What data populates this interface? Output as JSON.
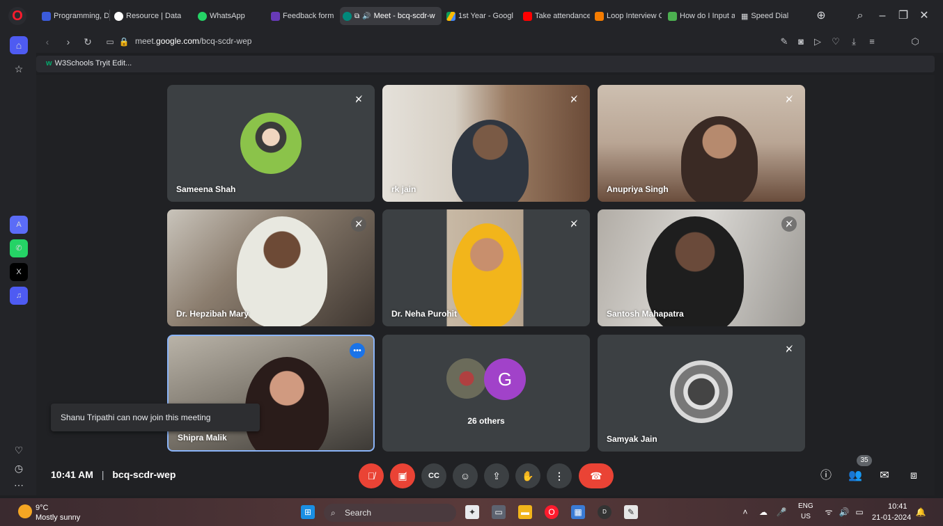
{
  "browser": {
    "tabs": [
      {
        "label": "Programming, D",
        "color": "#3b5bdb"
      },
      {
        "label": "Resource | Data S",
        "color": "#ffffff"
      },
      {
        "label": "WhatsApp",
        "color": "#25d366"
      },
      {
        "label": "Feedback form",
        "color": "#673ab7"
      },
      {
        "label": "Meet - bcq-scdr-w",
        "color": "#00897b"
      },
      {
        "label": "1st Year - Google",
        "color": "#fbbc04"
      },
      {
        "label": "Take attendance",
        "color": "#ff0000"
      },
      {
        "label": "Loop Interview C",
        "color": "#f57c00"
      },
      {
        "label": "How do I Input a",
        "color": "#4caf50"
      },
      {
        "label": "Speed Dial",
        "color": "#9e9e9e"
      }
    ],
    "url_prefix": "meet.",
    "url_domain": "google.com",
    "url_path": "/bcq-scdr-wep",
    "bookmark": "W3Schools Tryit Edit..."
  },
  "meeting": {
    "participants": [
      {
        "name": "Sameena Shah",
        "muted": true
      },
      {
        "name": "rk jain",
        "muted": true
      },
      {
        "name": "Anupriya Singh",
        "muted": true
      },
      {
        "name": "Dr. Hepzibah Mary",
        "muted": true
      },
      {
        "name": "Dr. Neha Purohit",
        "muted": true
      },
      {
        "name": "Santosh Mahapatra",
        "muted": true
      },
      {
        "name": "Shipra Malik",
        "muted": false
      },
      {
        "name": "26 others",
        "muted": false
      },
      {
        "name": "Samyak Jain",
        "muted": true
      }
    ],
    "others_avatar_letter": "G",
    "notice": "Shanu Tripathi can now join this meeting",
    "time": "10:41 AM",
    "separator": "|",
    "meeting_code": "bcq-scdr-wep",
    "participant_count": "35",
    "more_icon": "•••"
  },
  "taskbar": {
    "temp": "9°C",
    "weather": "Mostly sunny",
    "search_label": "Search",
    "lang_line1": "ENG",
    "lang_line2": "US",
    "clock_time": "10:41",
    "clock_date": "21-01-2024"
  }
}
